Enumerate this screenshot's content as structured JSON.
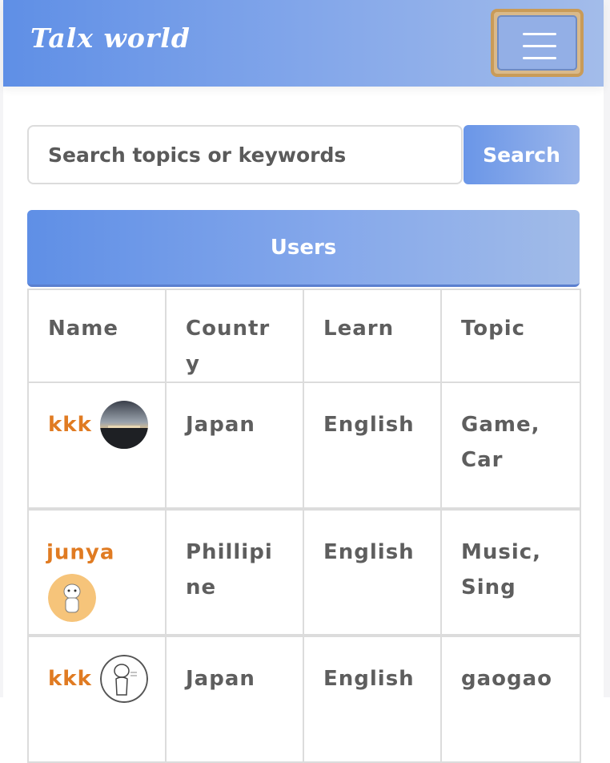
{
  "navbar": {
    "brand": "Talx world",
    "menu_icon": "hamburger-menu-icon"
  },
  "search": {
    "placeholder": "Search topics or keywords",
    "value": "",
    "button_label": "Search"
  },
  "users": {
    "title": "Users",
    "columns": [
      "Name",
      "Country",
      "Learn",
      "Topic"
    ],
    "rows": [
      {
        "name": "kkk",
        "avatar": "sunset-photo-avatar",
        "country": "Japan",
        "learn": "English",
        "topic": "Game, Car"
      },
      {
        "name": "junya",
        "avatar": "cartoon-character-avatar",
        "country": "Phillipine",
        "learn": "English",
        "topic": "Music, Sing"
      },
      {
        "name": "kkk",
        "avatar": "sketch-character-avatar",
        "country": "Japan",
        "learn": "English",
        "topic": "gaogao"
      }
    ]
  },
  "colors": {
    "accent": "#5f8fe6",
    "username": "#e07b22",
    "focus_ring": "#c99b58"
  }
}
